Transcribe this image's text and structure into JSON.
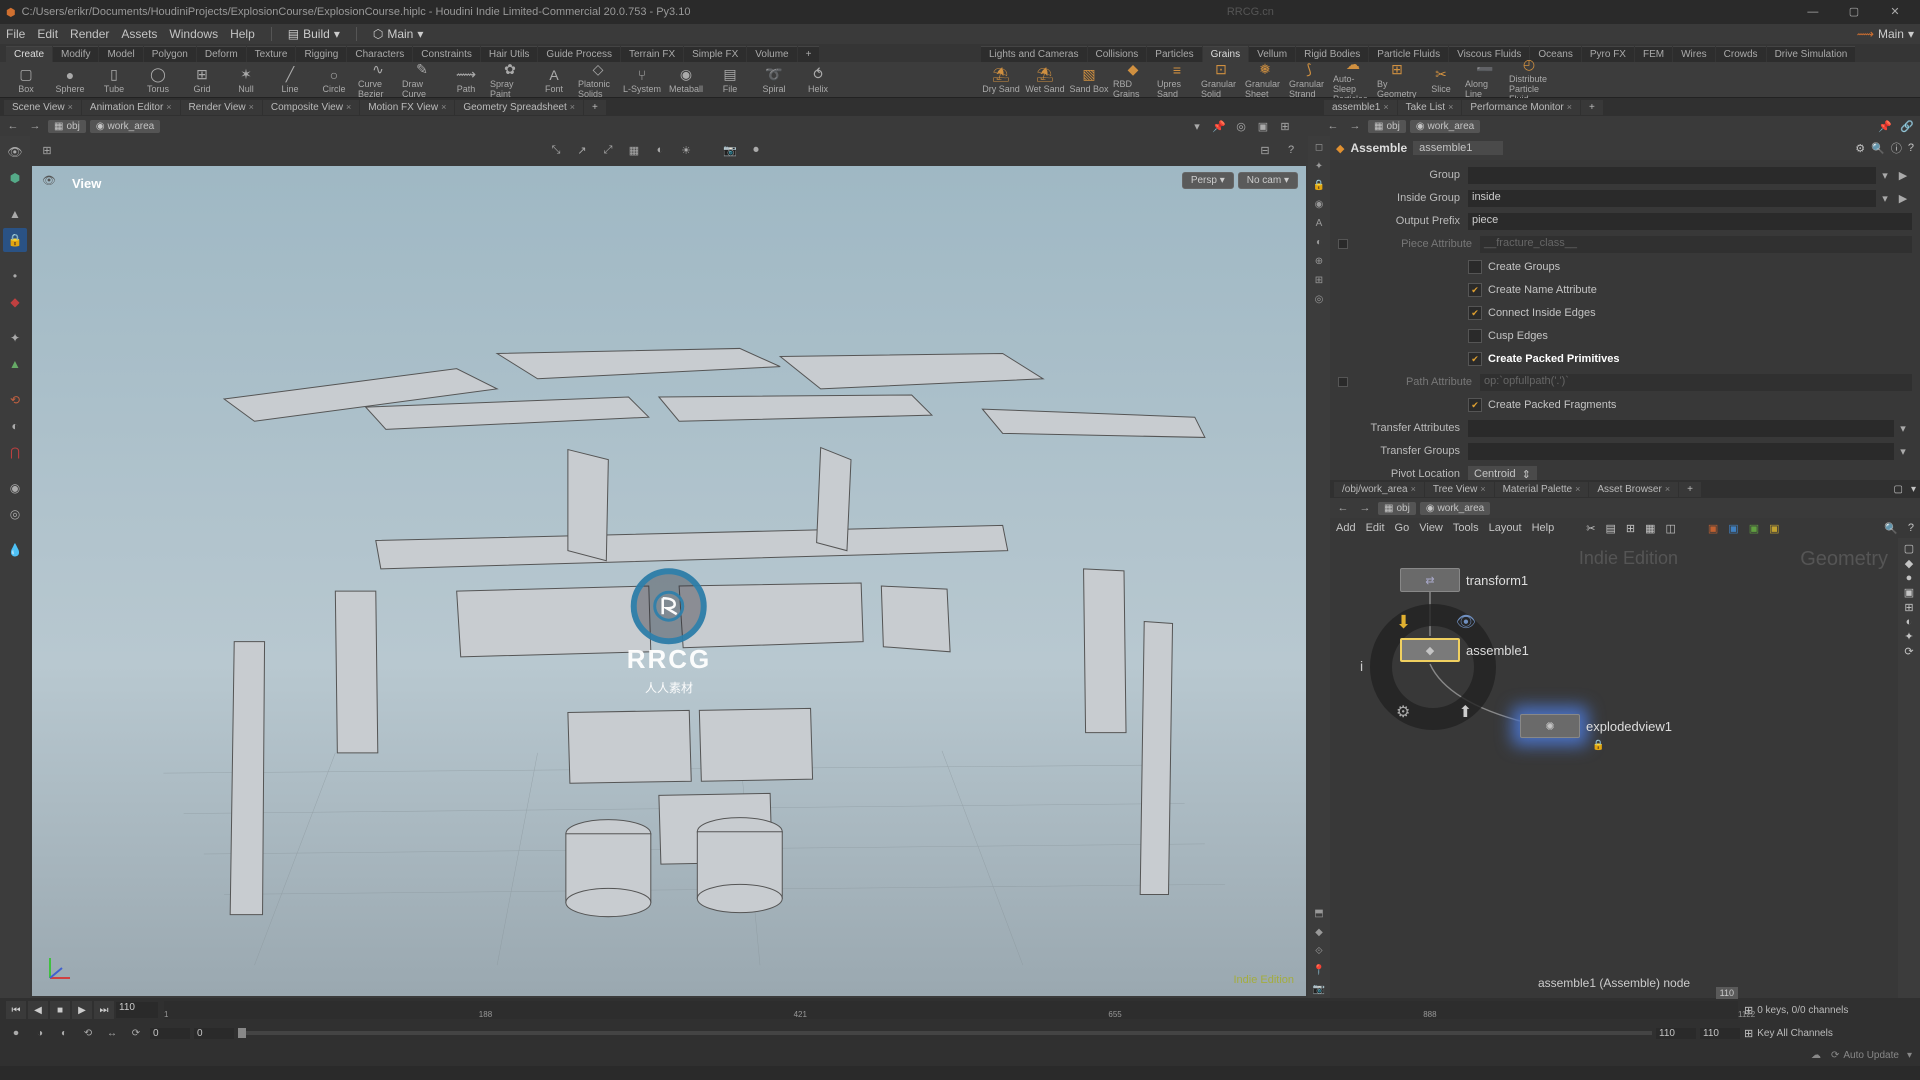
{
  "title": {
    "path": "C:/Users/erikr/Documents/HoudiniProjects/ExplosionCourse/ExplosionCourse.hiplc - Houdini Indie Limited-Commercial 20.0.753 - Py3.10",
    "watermark_top": "RRCG.cn"
  },
  "menubar": {
    "file": "File",
    "edit": "Edit",
    "render": "Render",
    "assets": "Assets",
    "windows": "Windows",
    "help": "Help",
    "desktop": "Build",
    "take": "Main",
    "take_right": "Main"
  },
  "shelf_tabs_left": [
    "Create",
    "Modify",
    "Model",
    "Polygon",
    "Deform",
    "Texture",
    "Rigging",
    "Characters",
    "Constraints",
    "Hair Utils",
    "Guide Process",
    "Terrain FX",
    "Simple FX",
    "Volume"
  ],
  "shelf_left": [
    {
      "icon": "▢",
      "label": "Box"
    },
    {
      "icon": "●",
      "label": "Sphere"
    },
    {
      "icon": "▯",
      "label": "Tube"
    },
    {
      "icon": "◯",
      "label": "Torus"
    },
    {
      "icon": "⊞",
      "label": "Grid"
    },
    {
      "icon": "✶",
      "label": "Null"
    },
    {
      "icon": "╱",
      "label": "Line"
    },
    {
      "icon": "○",
      "label": "Circle"
    },
    {
      "icon": "∿",
      "label": "Curve Bezier"
    },
    {
      "icon": "✎",
      "label": "Draw Curve"
    },
    {
      "icon": "⟿",
      "label": "Path"
    },
    {
      "icon": "✿",
      "label": "Spray Paint"
    },
    {
      "icon": "A",
      "label": "Font"
    },
    {
      "icon": "◇",
      "label": "Platonic Solids"
    },
    {
      "icon": "⑂",
      "label": "L-System"
    },
    {
      "icon": "◉",
      "label": "Metaball"
    },
    {
      "icon": "▤",
      "label": "File"
    },
    {
      "icon": "➰",
      "label": "Spiral"
    },
    {
      "icon": "⥀",
      "label": "Helix"
    }
  ],
  "shelf_tabs_right": [
    "Lights and Cameras",
    "Collisions",
    "Particles",
    "Grains",
    "Vellum",
    "Rigid Bodies",
    "Particle Fluids",
    "Viscous Fluids",
    "Oceans",
    "Pyro FX",
    "FEM",
    "Wires",
    "Crowds",
    "Drive Simulation"
  ],
  "shelf_right": [
    {
      "icon": "⛱",
      "label": "Dry Sand"
    },
    {
      "icon": "⛱",
      "label": "Wet Sand"
    },
    {
      "icon": "▧",
      "label": "Sand Box"
    },
    {
      "icon": "◆",
      "label": "RBD Grains"
    },
    {
      "icon": "≡",
      "label": "Upres Sand"
    },
    {
      "icon": "⊡",
      "label": "Granular Solid"
    },
    {
      "icon": "❅",
      "label": "Granular Sheet"
    },
    {
      "icon": "⟆",
      "label": "Granular Strand"
    },
    {
      "icon": "☁",
      "label": "Auto-Sleep Particles"
    },
    {
      "icon": "⊞",
      "label": "By Geometry"
    },
    {
      "icon": "✂",
      "label": "Slice"
    },
    {
      "icon": "➖",
      "label": "Along Line"
    },
    {
      "icon": "◴",
      "label": "Distribute Particle Fluid"
    }
  ],
  "scene_tabs": [
    "Scene View",
    "Animation Editor",
    "Render View",
    "Composite View",
    "Motion FX View",
    "Geometry Spreadsheet"
  ],
  "viewport": {
    "path_obj": "obj",
    "path_node": "work_area",
    "label": "View",
    "persp": "Persp ▾",
    "nocam": "No cam ▾",
    "edition": "Indie Edition"
  },
  "params": {
    "tab1": "assemble1",
    "tab2": "Take List",
    "tab3": "Performance Monitor",
    "type": "Assemble",
    "name": "assemble1",
    "group_label": "Group",
    "group_val": "",
    "inside_group_label": "Inside Group",
    "inside_group_val": "inside",
    "output_prefix_label": "Output Prefix",
    "output_prefix_val": "piece",
    "piece_attr_label": "Piece Attribute",
    "piece_attr_val": "__fracture_class__",
    "cb_create_groups": "Create Groups",
    "cb_create_name_attr": "Create Name Attribute",
    "cb_connect_inside": "Connect Inside Edges",
    "cb_cusp": "Cusp Edges",
    "cb_packed_prim": "Create Packed Primitives",
    "path_attr_label": "Path Attribute",
    "path_attr_val": "op:`opfullpath('.')`",
    "cb_packed_frag": "Create Packed Fragments",
    "transfer_attr_label": "Transfer Attributes",
    "transfer_groups_label": "Transfer Groups",
    "pivot_label": "Pivot Location",
    "pivot_val": "Centroid"
  },
  "network": {
    "tab1": "/obj/work_area",
    "tab2": "Tree View",
    "tab3": "Material Palette",
    "tab4": "Asset Browser",
    "path_obj": "obj",
    "path_node": "work_area",
    "menus": {
      "add": "Add",
      "edit": "Edit",
      "go": "Go",
      "view": "View",
      "tools": "Tools",
      "layout": "Layout",
      "help": "Help"
    },
    "node_transform": "transform1",
    "node_assemble": "assemble1",
    "node_exploded": "explodedview1",
    "wm_indie": "Indie Edition",
    "wm_geom": "Geometry",
    "status": "assemble1 (Assemble) node"
  },
  "timeline": {
    "frame": "110",
    "end_marker": "110",
    "ticks": [
      "1",
      "188",
      "421",
      "655",
      "888",
      "1122"
    ],
    "rstart": "0",
    "rzero": "0",
    "rend": "110",
    "rend2": "110",
    "keys": "0 keys, 0/0 channels",
    "keyall": "Key All Channels",
    "auto": "Auto Update"
  },
  "logo": {
    "text": "RRCG",
    "sub": "人人素材"
  }
}
